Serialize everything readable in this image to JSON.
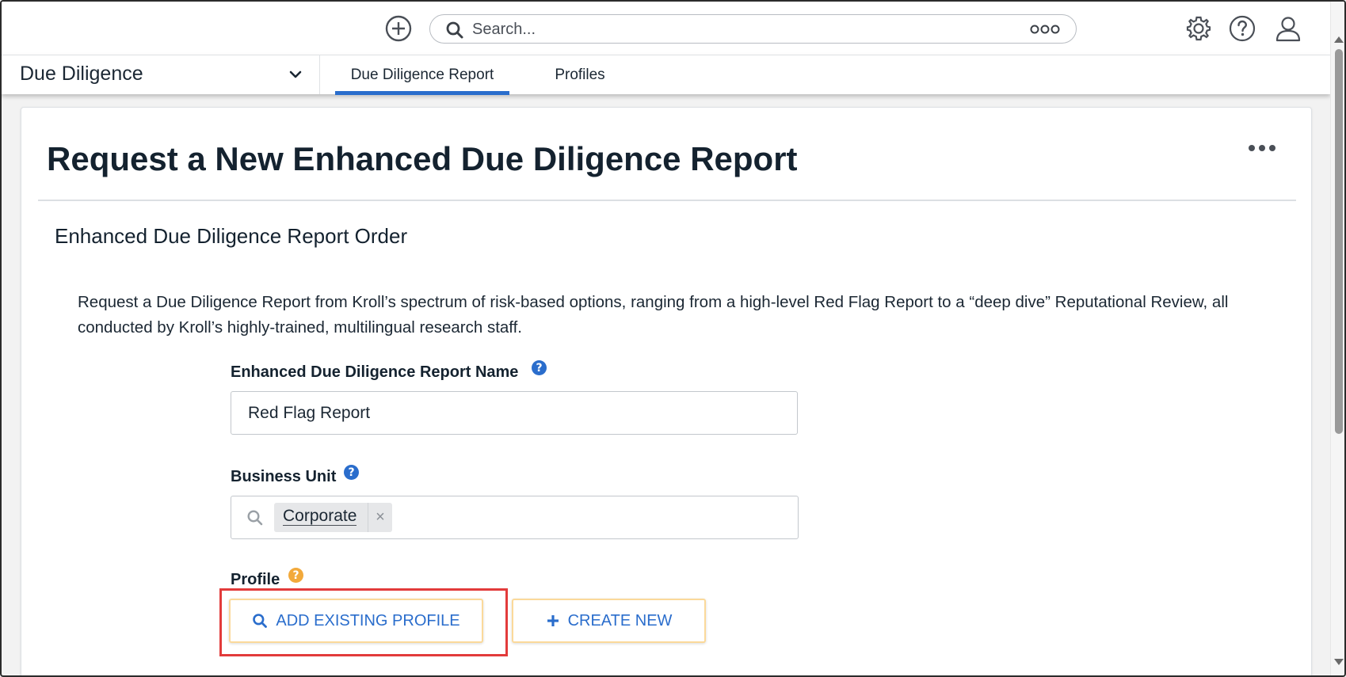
{
  "topbar": {
    "add_icon": "plus-circle-icon",
    "search": {
      "placeholder": "Search...",
      "search_icon": "search-icon",
      "options_icon": "more-options-icon"
    },
    "settings_icon": "gear-icon",
    "help_icon": "help-circle-icon",
    "user_icon": "user-icon"
  },
  "nav": {
    "app_name": "Due Diligence",
    "app_chevron_icon": "chevron-down-icon",
    "tabs": [
      {
        "label": "Due Diligence Report",
        "active": true
      },
      {
        "label": "Profiles",
        "active": false
      }
    ]
  },
  "page": {
    "title": "Request a New Enhanced Due Diligence Report",
    "more_icon": "more-horizontal-icon",
    "section_title": "Enhanced Due Diligence Report Order",
    "description": "Request a Due Diligence Report from Kroll’s spectrum of risk-based options, ranging from a high-level Red Flag Report to a “deep dive” Reputational Review, all conducted by Kroll’s highly-trained, multilingual research staff."
  },
  "form": {
    "report_name": {
      "label": "Enhanced Due Diligence Report Name",
      "help": "?",
      "value": "Red Flag Report"
    },
    "business_unit": {
      "label": "Business Unit",
      "help": "?",
      "chips": [
        {
          "label": "Corporate",
          "remove": "×"
        }
      ]
    },
    "profile": {
      "label": "Profile",
      "help": "?",
      "add_existing_label": "ADD EXISTING PROFILE",
      "create_new_label": "CREATE NEW"
    }
  },
  "colors": {
    "accent": "#2a6dcc",
    "title": "#14222f",
    "required_help": "#f2a93b",
    "button_border": "#fbd99a",
    "highlight": "#e23b3b"
  }
}
